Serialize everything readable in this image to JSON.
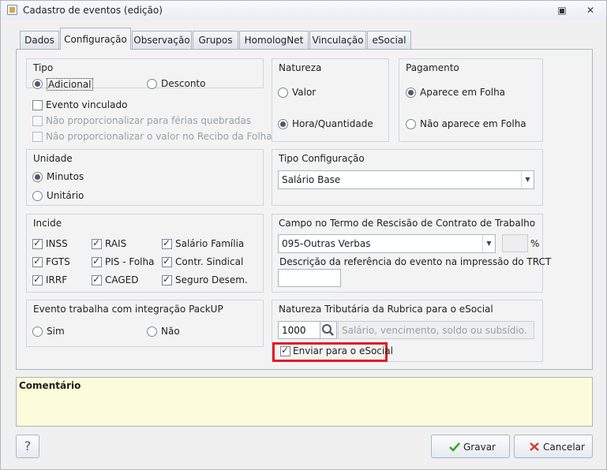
{
  "window": {
    "title": "Cadastro de eventos (edição)",
    "buttons": {
      "restore": "▣",
      "close": "✕"
    }
  },
  "tabs": [
    {
      "label": "Dados",
      "active": false
    },
    {
      "label": "Configuração",
      "active": true
    },
    {
      "label": "Observação",
      "active": false
    },
    {
      "label": "Grupos",
      "active": false
    },
    {
      "label": "HomologNet",
      "active": false
    },
    {
      "label": "Vinculação",
      "active": false
    },
    {
      "label": "eSocial",
      "active": false
    }
  ],
  "tipo": {
    "title": "Tipo",
    "options": [
      {
        "label": "Adicional",
        "checked": true
      },
      {
        "label": "Desconto",
        "checked": false
      }
    ]
  },
  "evento_checks": [
    {
      "label": "Evento vinculado",
      "checked": false,
      "disabled": false
    },
    {
      "label": "Não proporcionalizar para férias quebradas",
      "checked": false,
      "disabled": true
    },
    {
      "label": "Não proporcionalizar o valor no Recibo da Folha",
      "checked": false,
      "disabled": true
    }
  ],
  "natureza": {
    "title": "Natureza",
    "options": [
      {
        "label": "Valor",
        "checked": false
      },
      {
        "label": "Hora/Quantidade",
        "checked": true
      }
    ]
  },
  "pagamento": {
    "title": "Pagamento",
    "options": [
      {
        "label": "Aparece em Folha",
        "checked": true
      },
      {
        "label": "Não aparece em Folha",
        "checked": false
      }
    ]
  },
  "unidade": {
    "title": "Unidade",
    "options": [
      {
        "label": "Minutos",
        "checked": true
      },
      {
        "label": "Unitário",
        "checked": false
      }
    ]
  },
  "tipo_configuracao": {
    "title": "Tipo Configuração",
    "selected": "Salário Base"
  },
  "incide": {
    "title": "Incide",
    "items": [
      {
        "label": "INSS",
        "checked": true
      },
      {
        "label": "RAIS",
        "checked": true
      },
      {
        "label": "Salário Família",
        "checked": true
      },
      {
        "label": "FGTS",
        "checked": true
      },
      {
        "label": "PIS - Folha",
        "checked": true
      },
      {
        "label": "Contr. Sindical",
        "checked": true
      },
      {
        "label": "IRRF",
        "checked": true
      },
      {
        "label": "CAGED",
        "checked": true
      },
      {
        "label": "Seguro Desem.",
        "checked": true
      }
    ]
  },
  "rescisao": {
    "title": "Campo no Termo de Rescisão de Contrato de Trabalho",
    "selected": "095-Outras Verbas",
    "percent_symbol": "%",
    "percent_value": "",
    "descricao_label": "Descrição da referência do evento na impressão do TRCT",
    "descricao_value": ""
  },
  "packup": {
    "title": "Evento trabalha com integração PackUP",
    "options": [
      {
        "label": "Sim",
        "checked": false
      },
      {
        "label": "Não",
        "checked": false
      }
    ]
  },
  "natureza_tributaria": {
    "title": "Natureza Tributária da Rubrica para o eSocial",
    "code": "1000",
    "description_placeholder": "Salário, vencimento, soldo ou subsídio.",
    "send_label": "Enviar para o eSocial",
    "send_checked": true
  },
  "comment": {
    "label": "Comentário"
  },
  "footer": {
    "help": "?",
    "save": "Gravar",
    "cancel": "Cancelar"
  },
  "colors": {
    "highlight": "#e11d24",
    "comment_bg": "#fcfcda"
  }
}
